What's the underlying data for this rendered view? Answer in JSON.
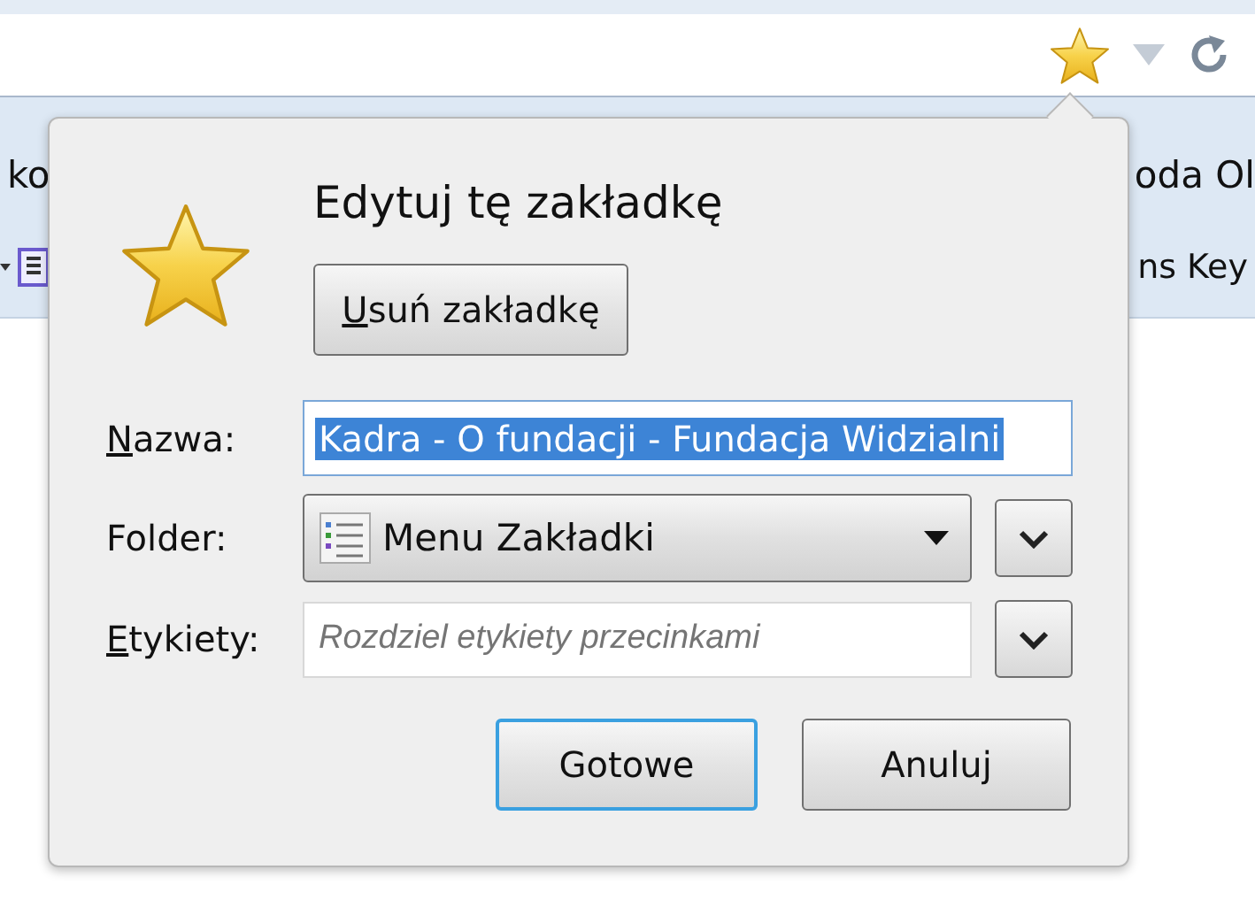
{
  "bookmarks_bar": {
    "row_1": {
      "left_text": "ko",
      "right_text": "oda Ol"
    },
    "row_2": {
      "right_text": "ns Key"
    }
  },
  "panel": {
    "title": "Edytuj tę zakładkę",
    "remove_button": {
      "label": "Usuń zakładkę",
      "underline_first": true
    },
    "fields": [
      {
        "kind": "text",
        "label": "Nazwa:",
        "underline_first": true,
        "value": "Kadra - O fundacji - Fundacja Widzialni",
        "text_selected": true
      },
      {
        "kind": "select",
        "label": "Folder:",
        "underline_first": false,
        "value": "Menu Zakładki"
      },
      {
        "kind": "tags",
        "label": "Etykiety:",
        "underline_first": true,
        "placeholder": "Rozdziel etykiety przecinkami"
      }
    ],
    "buttons": [
      {
        "label": "Gotowe",
        "default": true
      },
      {
        "label": "Anuluj",
        "default": false
      }
    ]
  }
}
